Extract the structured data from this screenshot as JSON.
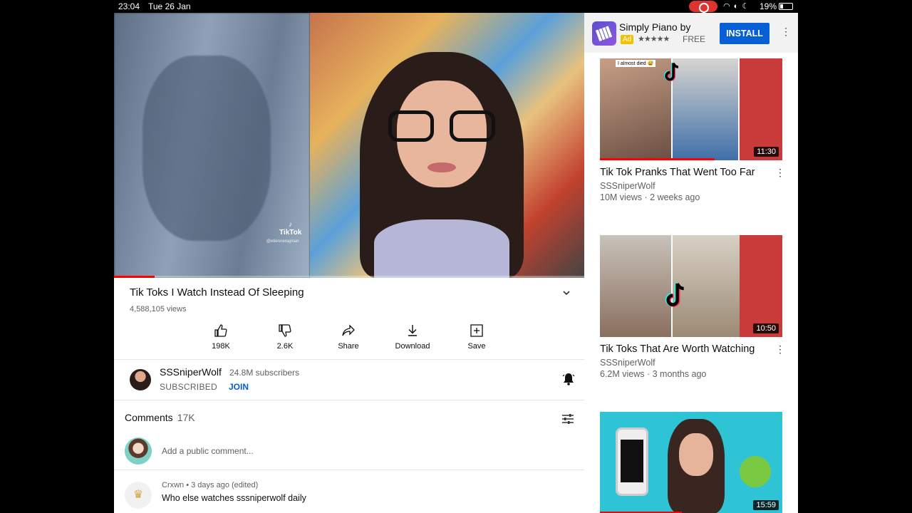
{
  "status_bar": {
    "time": "23:04",
    "date": "Tue 26 Jan",
    "battery": "19%"
  },
  "video": {
    "title": "Tik Toks I Watch Instead Of Sleeping",
    "views": "4,588,105 views",
    "watermark": "TikTok",
    "watermark_handle": "@etiennenajman",
    "progress_fraction": 0.087
  },
  "actions": {
    "like": "198K",
    "dislike": "2.6K",
    "share": "Share",
    "download": "Download",
    "save": "Save"
  },
  "channel": {
    "name": "SSSniperWolf",
    "subscribers": "24.8M subscribers",
    "subscribed_label": "SUBSCRIBED",
    "join_label": "JOIN"
  },
  "comments": {
    "heading": "Comments",
    "count": "17K",
    "placeholder": "Add a public comment...",
    "first": {
      "meta": "Crxwn • 3 days ago (edited)",
      "text": "Who else watches sssniperwolf daily"
    }
  },
  "ad": {
    "title": "Simply Piano by",
    "badge": "Ad",
    "stars": "★★★★★",
    "price": "FREE",
    "install": "INSTALL"
  },
  "recommendations": [
    {
      "title": "Tik Tok Pranks That Went Too Far",
      "channel": "SSSniperWolf",
      "meta": "10M views · 2 weeks ago",
      "duration": "11:30",
      "thumb_label": "I almost died 😅",
      "watched_fraction": 0.63
    },
    {
      "title": "Tik Toks That Are Worth Watching",
      "channel": "SSSniperWolf",
      "meta": "6.2M views · 3 months ago",
      "duration": "10:50"
    },
    {
      "duration": "15:59",
      "watched_fraction": 0.45
    }
  ],
  "colors": {
    "accent_red": "#ff0000",
    "link_blue": "#065fd4",
    "secondary_text": "#606060"
  }
}
